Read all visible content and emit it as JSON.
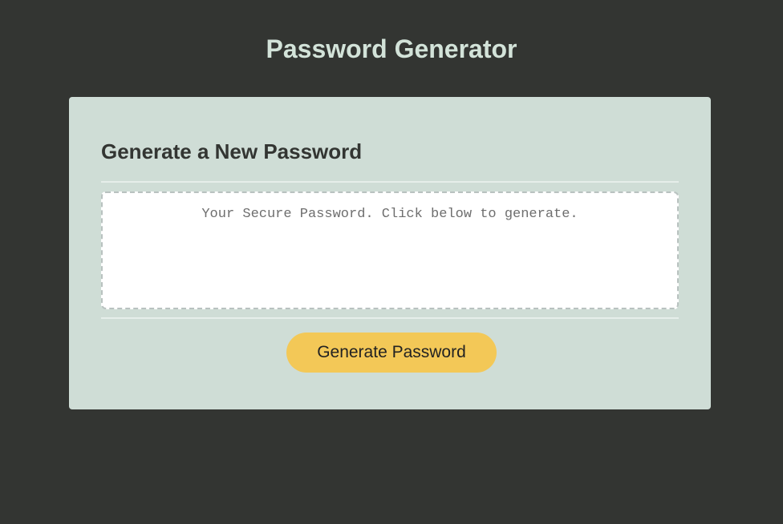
{
  "header": {
    "title": "Password Generator"
  },
  "card": {
    "heading": "Generate a New Password",
    "password_field": {
      "value": "",
      "placeholder": "Your Secure Password. Click below to generate."
    },
    "generate_button_label": "Generate Password"
  },
  "colors": {
    "page_background": "#333532",
    "title_text": "#d3e3d9",
    "card_background": "#cfddd6",
    "button_background": "#f3c857"
  }
}
